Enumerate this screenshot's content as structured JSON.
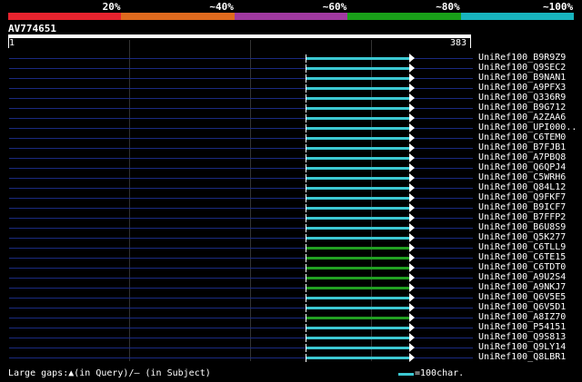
{
  "legend": {
    "segments": [
      {
        "label": "20%",
        "color": "#e8232e"
      },
      {
        "label": "~40%",
        "color": "#e06a1e"
      },
      {
        "label": "~60%",
        "color": "#a039a0"
      },
      {
        "label": "~80%",
        "color": "#19a019"
      },
      {
        "label": "~100%",
        "color": "#18b4be"
      }
    ]
  },
  "query": {
    "id": "AV774651",
    "start": "1",
    "end": "383"
  },
  "hits": [
    {
      "name": "UniRef100_B9R9Z9",
      "color": "#3cc8d2"
    },
    {
      "name": "UniRef100_Q9SEC2",
      "color": "#3cc8d2"
    },
    {
      "name": "UniRef100_B9NAN1",
      "color": "#3cc8d2"
    },
    {
      "name": "UniRef100_A9PFX3",
      "color": "#3cc8d2"
    },
    {
      "name": "UniRef100_Q336R9",
      "color": "#3cc8d2"
    },
    {
      "name": "UniRef100_B9G712",
      "color": "#3cc8d2"
    },
    {
      "name": "UniRef100_A2ZAA6",
      "color": "#3cc8d2"
    },
    {
      "name": "UniRef100_UPI000..",
      "color": "#3cc8d2"
    },
    {
      "name": "UniRef100_C6TEM0",
      "color": "#3cc8d2"
    },
    {
      "name": "UniRef100_B7FJB1",
      "color": "#3cc8d2"
    },
    {
      "name": "UniRef100_A7PBQ8",
      "color": "#3cc8d2"
    },
    {
      "name": "UniRef100_Q6QPJ4",
      "color": "#3cc8d2"
    },
    {
      "name": "UniRef100_C5WRH6",
      "color": "#3cc8d2"
    },
    {
      "name": "UniRef100_Q84L12",
      "color": "#3cc8d2"
    },
    {
      "name": "UniRef100_Q9FKF7",
      "color": "#3cc8d2"
    },
    {
      "name": "UniRef100_B9ICF7",
      "color": "#3cc8d2"
    },
    {
      "name": "UniRef100_B7FFP2",
      "color": "#3cc8d2"
    },
    {
      "name": "UniRef100_B6U8S9",
      "color": "#3cc8d2"
    },
    {
      "name": "UniRef100_Q5K277",
      "color": "#3cc8d2"
    },
    {
      "name": "UniRef100_C6TLL9",
      "color": "#22a022"
    },
    {
      "name": "UniRef100_C6TE15",
      "color": "#22a022"
    },
    {
      "name": "UniRef100_C6TDT0",
      "color": "#22a022"
    },
    {
      "name": "UniRef100_A9U2S4",
      "color": "#22a022"
    },
    {
      "name": "UniRef100_A9NKJ7",
      "color": "#22a022"
    },
    {
      "name": "UniRef100_Q6V5E5",
      "color": "#3cc8d2"
    },
    {
      "name": "UniRef100_Q6V5D1",
      "color": "#3cc8d2"
    },
    {
      "name": "UniRef100_A8IZ70",
      "color": "#22a022"
    },
    {
      "name": "UniRef100_P54151",
      "color": "#3cc8d2"
    },
    {
      "name": "UniRef100_Q9S813",
      "color": "#3cc8d2"
    },
    {
      "name": "UniRef100_Q9LY14",
      "color": "#3cc8d2"
    },
    {
      "name": "UniRef100_Q8LBR1",
      "color": "#3cc8d2"
    }
  ],
  "footer": {
    "gaps_text": "Large gaps:▲(in Query)/— (in Subject)",
    "scale_label": "=100char.",
    "scale_color": "#3cc8d2"
  }
}
